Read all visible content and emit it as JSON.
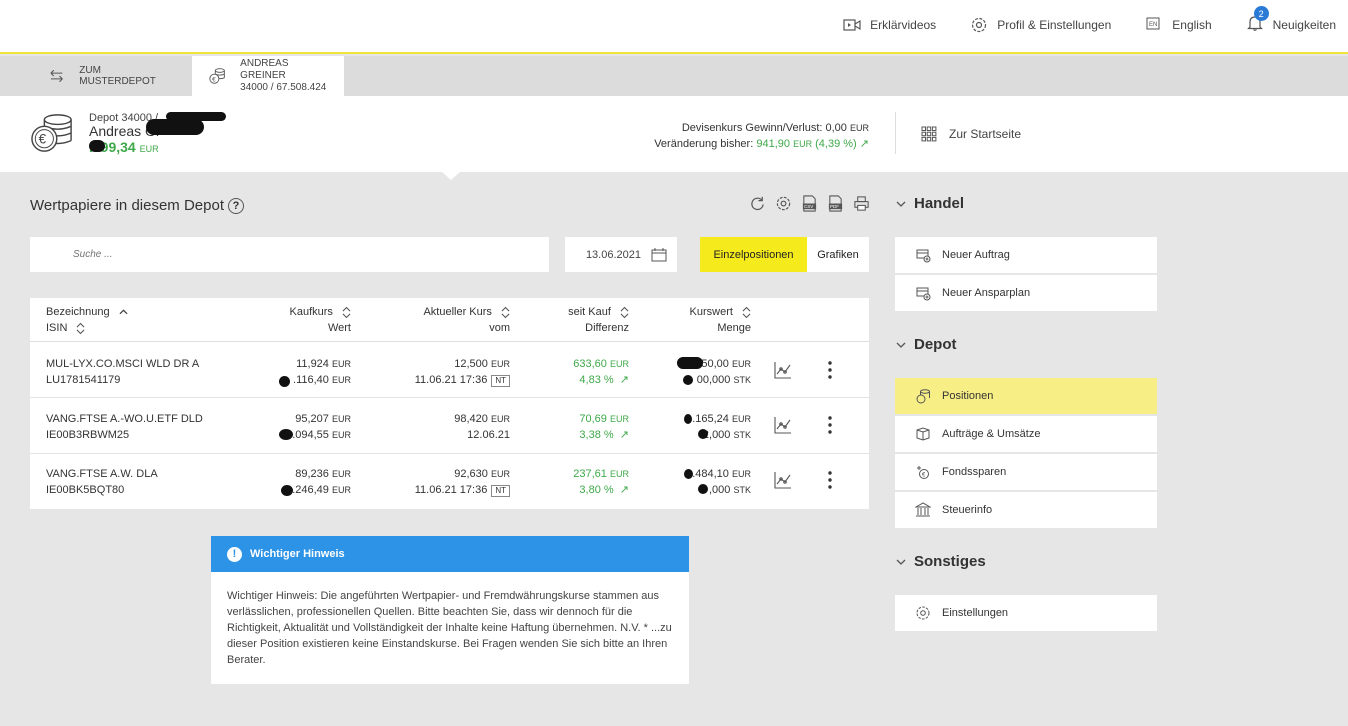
{
  "topbar": {
    "links": [
      {
        "icon": "video-icon",
        "label": "Erklärvideos"
      },
      {
        "icon": "gear-icon",
        "label": "Profil & Einstellungen"
      },
      {
        "icon": "language-icon",
        "label": "English"
      },
      {
        "icon": "bell-icon",
        "label": "Neuigkeiten",
        "badge": "2"
      }
    ]
  },
  "tabs": {
    "musterdepot": "ZUM MUSTERDEPOT",
    "account_name": "ANDREAS GREINER",
    "account_no": "34000 / 67.508.424"
  },
  "header": {
    "depot_label": "Depot 34000 /",
    "name": "Andreas Gr",
    "value": ".399,34",
    "value_unit": "EUR",
    "fx_label": "Devisenkurs Gewinn/Verlust:",
    "fx_value": "0,00",
    "fx_unit": "EUR",
    "change_label": "Veränderung bisher:",
    "change_value": "941,90",
    "change_unit": "EUR",
    "change_pct": "(4,39 %)",
    "start_link": "Zur Startseite"
  },
  "main": {
    "title": "Wertpapiere in diesem Depot",
    "help": "?",
    "search_placeholder": "Suche ...",
    "date": "13.06.2021",
    "btn_einzel": "Einzelpositionen",
    "btn_grafiken": "Grafiken"
  },
  "table": {
    "headers": {
      "bezeichnung": "Bezeichnung",
      "isin": "ISIN",
      "kaufkurs": "Kaufkurs",
      "wert": "Wert",
      "aktuell": "Aktueller Kurs",
      "vom": "vom",
      "seit_kauf": "seit Kauf",
      "differenz": "Differenz",
      "kurswert": "Kurswert",
      "menge": "Menge"
    },
    "rows": [
      {
        "name": "MUL-LYX.CO.MSCI WLD DR A",
        "isin": "LU1781541179",
        "kaufkurs": "11,924",
        "wert": ".116,40",
        "kurs": "12,500",
        "vom": "11.06.21 17:36",
        "nt": "NT",
        "diff": "633,60",
        "diff_pct": "4,83 %",
        "kurswert": "50,00",
        "menge": "00,000"
      },
      {
        "name": "VANG.FTSE A.-WO.U.ETF DLD",
        "isin": "IE00B3RBWM25",
        "kaufkurs": "95,207",
        "wert": ".094,55",
        "kurs": "98,420",
        "vom": "12.06.21",
        "nt": "",
        "diff": "70,69",
        "diff_pct": "3,38 %",
        "kurswert": ".165,24",
        "menge": "2,000"
      },
      {
        "name": "VANG.FTSE A.W. DLA",
        "isin": "IE00BK5BQT80",
        "kaufkurs": "89,236",
        "wert": ".246,49",
        "kurs": "92,630",
        "vom": "11.06.21 17:36",
        "nt": "NT",
        "diff": "237,61",
        "diff_pct": "3,80 %",
        "kurswert": ".484,10",
        "menge": ",000"
      }
    ],
    "unit_eur": "EUR",
    "unit_stk": "STK"
  },
  "notice": {
    "title": "Wichtiger Hinweis",
    "text": "Wichtiger Hinweis: Die angeführten Wertpapier- und Fremdwährungskurse stammen aus verlässlichen, professionellen Quellen. Bitte beachten Sie, dass wir dennoch für die Richtigkeit, Aktualität und Vollständigkeit der Inhalte keine Haftung übernehmen.",
    "nv": "N.V. * ...zu dieser Position existieren keine Einstandskurse. Bei Fragen wenden Sie sich bitte an Ihren Berater."
  },
  "sidebar": {
    "handel": "Handel",
    "neuer_auftrag": "Neuer Auftrag",
    "neuer_ansparplan": "Neuer Ansparplan",
    "depot": "Depot",
    "positionen": "Positionen",
    "auftraege": "Aufträge & Umsätze",
    "fondssparen": "Fondssparen",
    "steuerinfo": "Steuerinfo",
    "sonstiges": "Sonstiges",
    "einstellungen": "Einstellungen"
  },
  "colors": {
    "accent_yellow": "#f4ea1c",
    "positive_green": "#3fa84a",
    "notice_blue": "#2d93e6"
  }
}
